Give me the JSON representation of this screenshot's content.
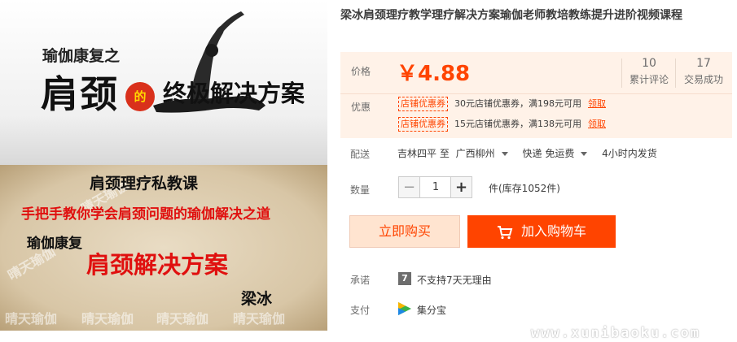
{
  "gallery": {
    "top_banner": {
      "line1": "瑜伽康复之",
      "line2": "肩颈",
      "connector": "的",
      "line3": "终极解决方案"
    },
    "bottom_banner": {
      "heading": "肩颈理疗私教课",
      "slogan": "手把手教你学会肩颈问题的瑜伽解决之道",
      "subtitle": "瑜伽康复",
      "main": "肩颈解决方案",
      "author": "梁冰",
      "watermark": "晴天瑜伽"
    }
  },
  "product": {
    "title": "梁冰肩颈理疗教学理疗解决方案瑜伽老师教培教练提升进阶视频课程",
    "price_label": "价格",
    "price": "￥4.88",
    "stats": [
      {
        "num": "10",
        "label": "累计评论"
      },
      {
        "num": "17",
        "label": "交易成功"
      }
    ],
    "promo_label": "优惠",
    "coupons": [
      {
        "tag": "店铺优惠券",
        "text": "30元店铺优惠券，满198元可用",
        "link": "领取"
      },
      {
        "tag": "店铺优惠券",
        "text": "15元店铺优惠券，满138元可用",
        "link": "领取"
      }
    ],
    "shipping": {
      "label": "配送",
      "from": "吉林四平 至",
      "to": "广西柳州",
      "method": "快递 免运费",
      "time": "4小时内发货"
    },
    "quantity": {
      "label": "数量",
      "minus": "−",
      "value": "1",
      "plus": "+",
      "stock": "件(库存1052件)"
    },
    "buttons": {
      "buy_now": "立即购买",
      "add_to_cart": "加入购物车"
    },
    "promise": {
      "label": "承诺",
      "icon_text": "7",
      "text": "不支持7天无理由"
    },
    "payment": {
      "label": "支付",
      "text": "集分宝"
    }
  },
  "site_watermark": "www.xunibaoku.com",
  "colors": {
    "accent": "#ff4400",
    "price_bg": "#fff2e8"
  }
}
